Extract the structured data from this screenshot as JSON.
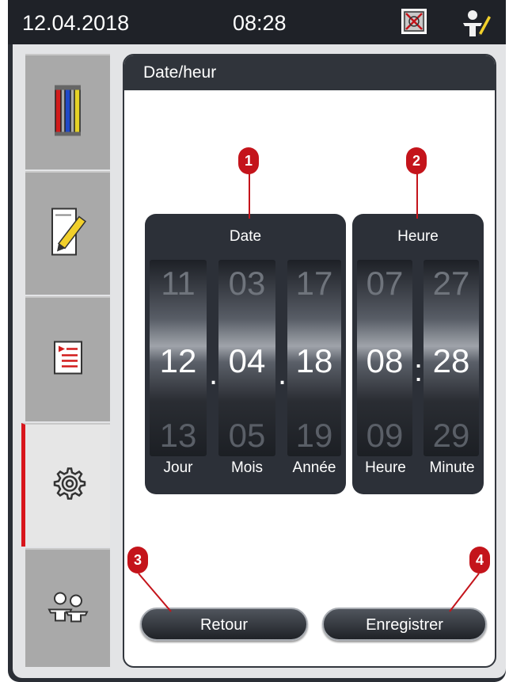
{
  "status_bar": {
    "date": "12.04.2018",
    "time": "08:28"
  },
  "sidebar": {
    "tabs": [
      {
        "name": "reagents"
      },
      {
        "name": "program-edit"
      },
      {
        "name": "protocol-list"
      },
      {
        "name": "settings",
        "active": true
      },
      {
        "name": "user"
      }
    ]
  },
  "panel": {
    "title": "Date/heur"
  },
  "date_drum": {
    "title": "Date",
    "columns": [
      {
        "label": "Jour",
        "prev": "11",
        "current": "12",
        "next": "13"
      },
      {
        "label": "Mois",
        "prev": "03",
        "current": "04",
        "next": "05"
      },
      {
        "label": "Année",
        "prev": "17",
        "current": "18",
        "next": "19"
      }
    ],
    "separator": "."
  },
  "time_drum": {
    "title": "Heure",
    "columns": [
      {
        "label": "Heure",
        "prev": "07",
        "current": "08",
        "next": "09"
      },
      {
        "label": "Minute",
        "prev": "27",
        "current": "28",
        "next": "29"
      }
    ],
    "separator": ":"
  },
  "buttons": {
    "back": "Retour",
    "save": "Enregistrer"
  },
  "callouts": [
    "1",
    "2",
    "3",
    "4"
  ],
  "colors": {
    "accent": "#d8151c",
    "dark": "#2c3038"
  }
}
